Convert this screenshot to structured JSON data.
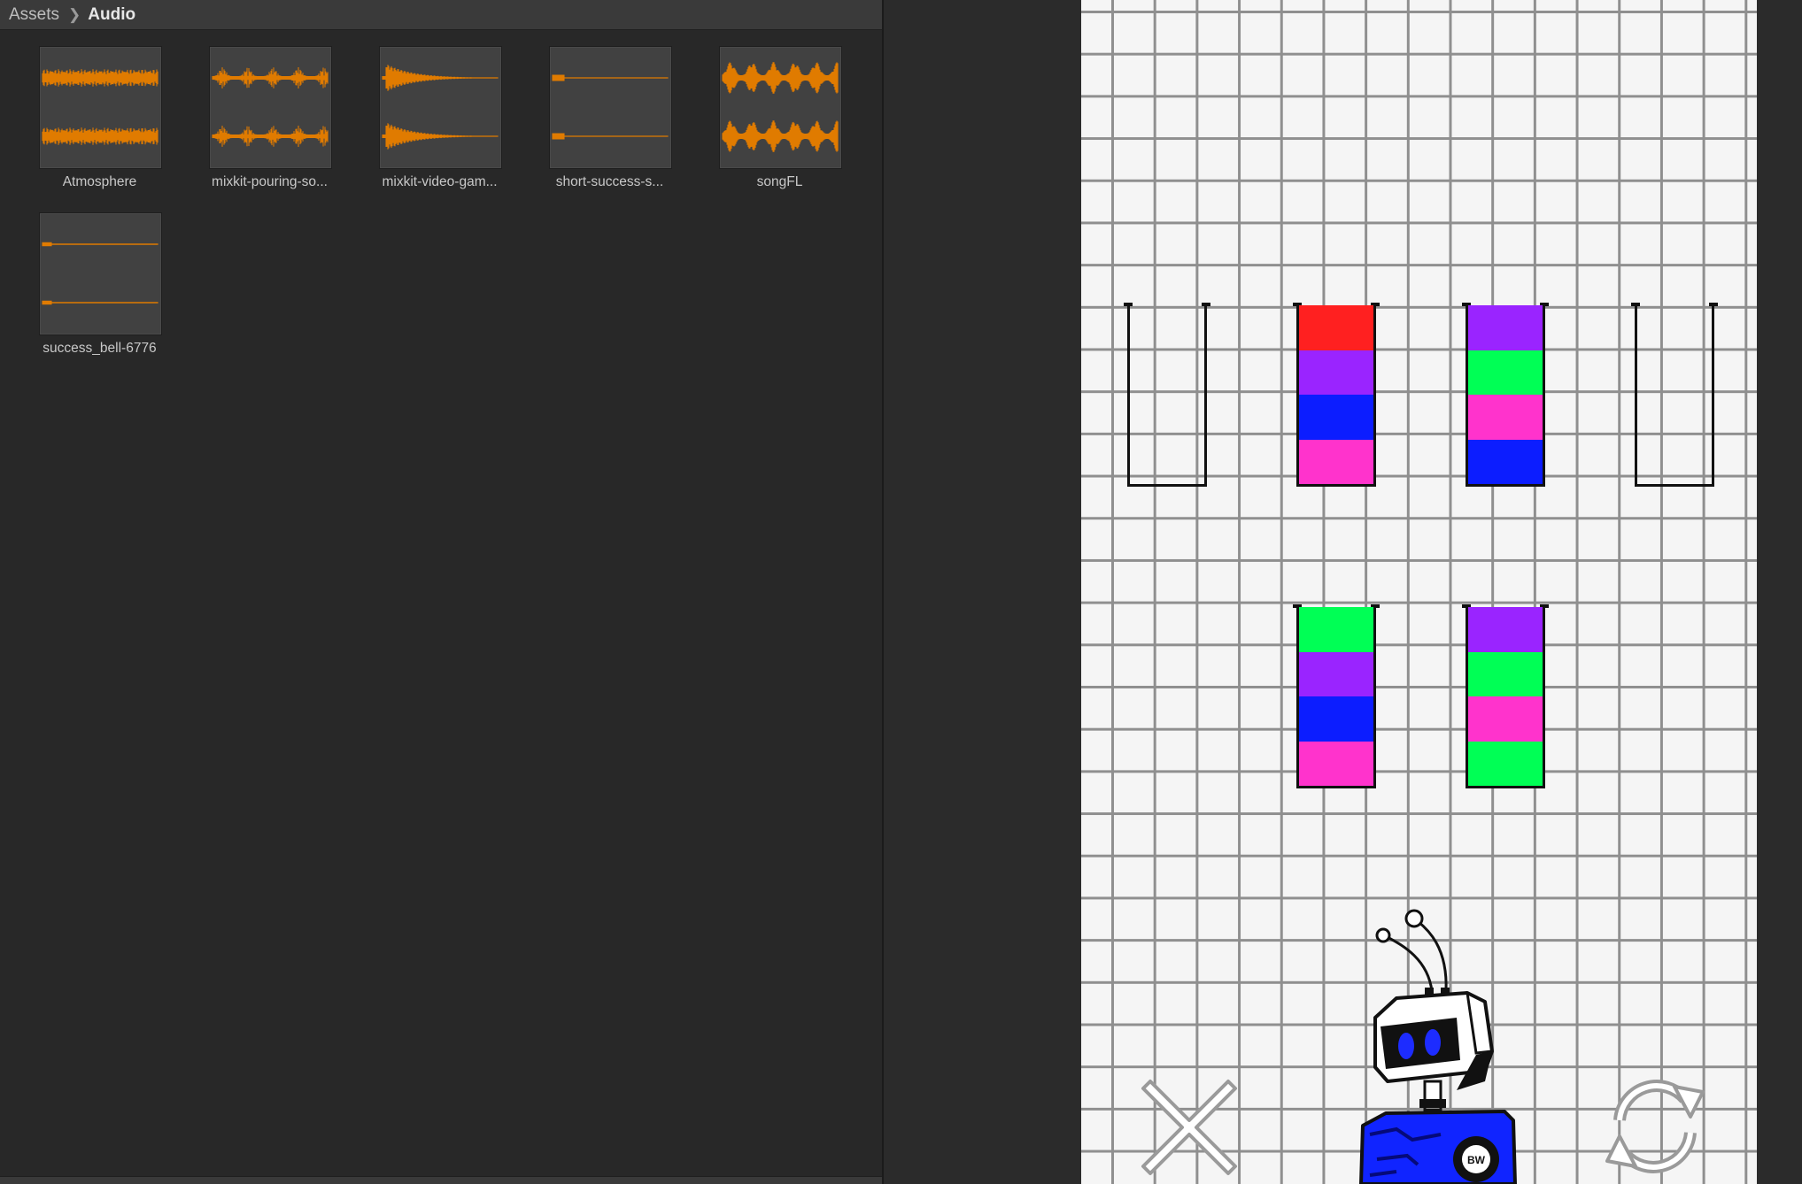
{
  "breadcrumb": {
    "root": "Assets",
    "current": "Audio"
  },
  "assets": [
    {
      "name": "Atmosphere",
      "waveform": "dense"
    },
    {
      "name": "mixkit-pouring-so...",
      "waveform": "bursts"
    },
    {
      "name": "mixkit-video-gam...",
      "waveform": "decay"
    },
    {
      "name": "short-success-s...",
      "waveform": "blip"
    },
    {
      "name": "songFL",
      "waveform": "beats"
    },
    {
      "name": "success_bell-6776",
      "waveform": "tail"
    }
  ],
  "colors": {
    "waveform": "#e07b00",
    "red": "#ff2020",
    "purple": "#9a24ff",
    "blue": "#0c1dff",
    "pink": "#ff33cc",
    "green": "#00ff55"
  },
  "tubes": [
    {
      "row": 0,
      "col": 0,
      "layers": []
    },
    {
      "row": 0,
      "col": 1,
      "layers": [
        "red",
        "purple",
        "blue",
        "pink"
      ]
    },
    {
      "row": 0,
      "col": 2,
      "layers": [
        "purple",
        "green",
        "pink",
        "blue"
      ]
    },
    {
      "row": 0,
      "col": 3,
      "layers": []
    },
    {
      "row": 1,
      "col": 1,
      "layers": [
        "green",
        "purple",
        "blue",
        "pink"
      ]
    },
    {
      "row": 1,
      "col": 2,
      "layers": [
        "purple",
        "green",
        "pink",
        "green"
      ]
    }
  ],
  "buttons": {
    "close": "close-icon",
    "restart": "restart-icon"
  },
  "robot_badge": "BW"
}
